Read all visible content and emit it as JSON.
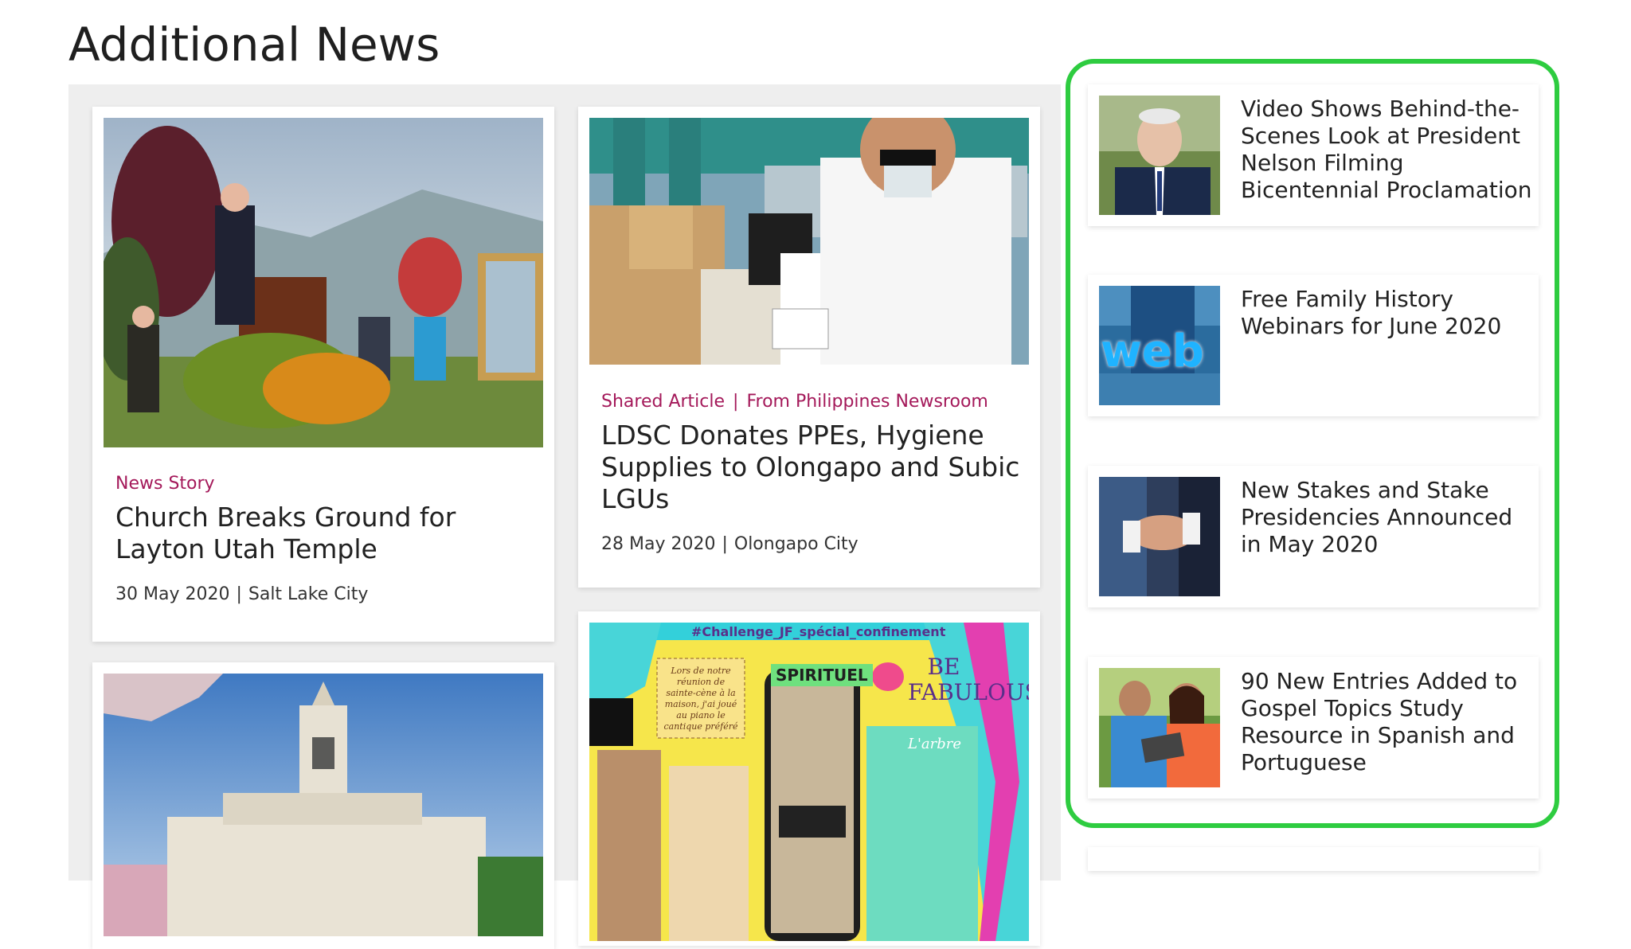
{
  "section": {
    "title": "Additional News"
  },
  "cards": [
    {
      "meta": [
        "News Story"
      ],
      "headline": "Church Breaks Ground for Layton Utah Temple",
      "date": "30 May 2020",
      "location": "Salt Lake City"
    },
    {
      "meta": [
        "Shared Article",
        "From Philippines Newsroom"
      ],
      "headline": "LDSC Donates PPEs, Hygiene Supplies to Olongapo and Subic LGUs",
      "date": "28 May 2020",
      "location": "Olongapo City"
    }
  ],
  "bottom_images": {
    "challenge_tag": "#Challenge_JF_spécial_confinement",
    "spirituel": "SPIRITUEL",
    "be_fabulous": "BE FABULOUS",
    "arbre": "L'arbre",
    "note": "Lors de notre réunion de sainte-cène à la maison, j'ai joué au piano le cantique préféré"
  },
  "side_items": [
    {
      "title": "Video Shows Behind-the-Scenes Look at President Nelson Filming Bicentennial Proclamation",
      "thumb_icon": "portrait-photo"
    },
    {
      "title": "Free Family History Webinars for June 2020",
      "thumb_icon": "web-photo",
      "thumb_text": "web"
    },
    {
      "title": "New Stakes and Stake Presidencies Announced in May 2020",
      "thumb_icon": "handshake-photo"
    },
    {
      "title": "90 New Entries Added to Gospel Topics Study Resource in Spanish and Portuguese",
      "thumb_icon": "tablet-photo"
    }
  ],
  "colors": {
    "accent": "#a4195a",
    "highlight": "#2ecc40",
    "panel": "#eeeeee"
  }
}
